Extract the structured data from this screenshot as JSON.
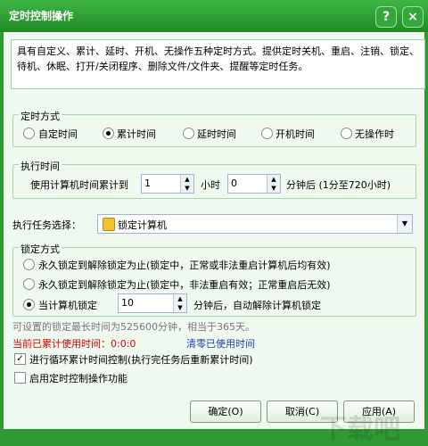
{
  "window": {
    "title": "定时控制操作",
    "help_icon": "?",
    "close_icon": "×"
  },
  "description": "具有自定义、累计、延时、开机、无操作五种定时方式。提供定时关机、重启、注销、锁定、待机、休眠、打开/关闭程序、删除文件/文件夹、提醒等定时任务。",
  "timing_mode": {
    "legend": "定时方式",
    "options": [
      "自定时间",
      "累计时间",
      "延时时间",
      "开机时间",
      "无操作时"
    ],
    "selected_index": 1
  },
  "execution_time": {
    "legend": "执行时间",
    "prefix": "使用计算机时间累计到",
    "hours_value": "1",
    "hours_label": "小时",
    "minutes_value": "0",
    "minutes_label": "分钟后 (1分至720小时)"
  },
  "task": {
    "label": "执行任务选择：",
    "selected": "锁定计算机"
  },
  "lock_mode": {
    "legend": "锁定方式",
    "option1": "永久锁定到解除锁定为止(锁定中，正常或非法重启计算机后均有效)",
    "option2": "永久锁定到解除锁定为止(锁定中，非法重启有效；正常重启后无效)",
    "option3": "当计算机锁定",
    "option3_value": "10",
    "option3_suffix": "分钟后，自动解除计算机锁定",
    "selected_index": 2
  },
  "info_note": "可设置的锁定最长时间为525600分钟，相当于365天。",
  "current_usage": "当前已累计使用时间：0:0:0",
  "clear_link": "清零已使用时间",
  "loop_checkbox": {
    "label": "进行循环累计时间控制(执行完任务后重新累计时间)",
    "checked": true
  },
  "enable_checkbox": {
    "label": "启用定时控制操作功能",
    "checked": false
  },
  "buttons": {
    "ok": "确定(O)",
    "cancel": "取消(C)",
    "apply": "应用(A)"
  },
  "watermark": "下载吧"
}
